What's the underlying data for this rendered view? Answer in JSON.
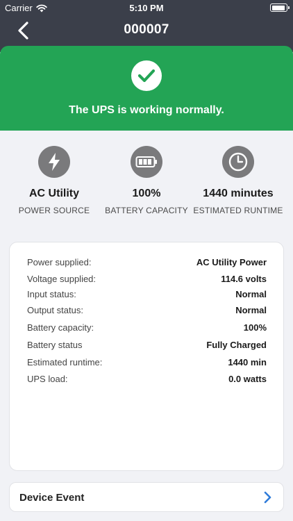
{
  "status_bar": {
    "carrier": "Carrier",
    "time": "5:10 PM"
  },
  "nav": {
    "title": "000007",
    "back_icon": "chevron-left-icon"
  },
  "banner": {
    "message": "The UPS is working normally.",
    "color": "#23a455",
    "icon": "checkmark-icon"
  },
  "summary": [
    {
      "icon": "lightning-bolt-icon",
      "value": "AC Utility",
      "label": "POWER SOURCE"
    },
    {
      "icon": "battery-icon",
      "value": "100%",
      "label": "BATTERY CAPACITY"
    },
    {
      "icon": "clock-icon",
      "value": "1440 minutes",
      "label": "ESTIMATED RUNTIME"
    }
  ],
  "details": [
    {
      "key": "Power supplied:",
      "value": "AC Utility Power"
    },
    {
      "key": "Voltage supplied:",
      "value": "114.6 volts"
    },
    {
      "key": "Input status:",
      "value": "Normal"
    },
    {
      "key": "Output status:",
      "value": "Normal"
    },
    {
      "key": "Battery capacity:",
      "value": "100%"
    },
    {
      "key": "Battery status",
      "value": "Fully Charged"
    },
    {
      "key": "Estimated runtime:",
      "value": "1440 min"
    },
    {
      "key": "UPS load:",
      "value": "0.0 watts"
    }
  ],
  "device_event": {
    "label": "Device Event",
    "chevron_color": "#2f7bd9"
  }
}
